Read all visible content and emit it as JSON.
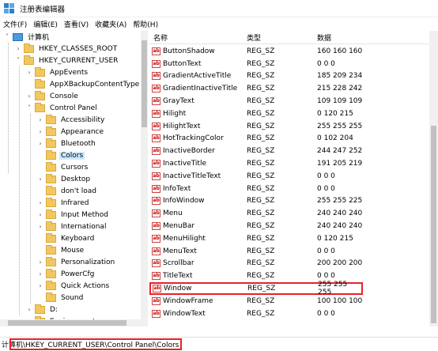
{
  "window": {
    "title": "注册表编辑器"
  },
  "menu": [
    "文件(F)",
    "编辑(E)",
    "查看(V)",
    "收藏夹(A)",
    "帮助(H)"
  ],
  "tree": {
    "items": [
      {
        "label": "计算机",
        "expander": "˅",
        "icon": "computer-icon",
        "selected": false
      },
      {
        "label": "HKEY_CLASSES_ROOT",
        "expander": "›",
        "icon": "folder-icon",
        "selected": false
      },
      {
        "label": "HKEY_CURRENT_USER",
        "expander": "˅",
        "icon": "folder-icon",
        "selected": false
      },
      {
        "label": "AppEvents",
        "expander": "›",
        "icon": "folder-icon",
        "selected": false
      },
      {
        "label": "AppXBackupContentType",
        "expander": "",
        "icon": "folder-icon",
        "selected": false
      },
      {
        "label": "Console",
        "expander": "›",
        "icon": "folder-icon",
        "selected": false
      },
      {
        "label": "Control Panel",
        "expander": "˅",
        "icon": "folder-icon",
        "selected": false
      },
      {
        "label": "Accessibility",
        "expander": "›",
        "icon": "folder-icon",
        "selected": false
      },
      {
        "label": "Appearance",
        "expander": "›",
        "icon": "folder-icon",
        "selected": false
      },
      {
        "label": "Bluetooth",
        "expander": "›",
        "icon": "folder-icon",
        "selected": false
      },
      {
        "label": "Colors",
        "expander": "",
        "icon": "folder-icon",
        "selected": true
      },
      {
        "label": "Cursors",
        "expander": "",
        "icon": "folder-icon",
        "selected": false
      },
      {
        "label": "Desktop",
        "expander": "›",
        "icon": "folder-icon",
        "selected": false
      },
      {
        "label": "don't load",
        "expander": "",
        "icon": "folder-icon",
        "selected": false
      },
      {
        "label": "Infrared",
        "expander": "›",
        "icon": "folder-icon",
        "selected": false
      },
      {
        "label": "Input Method",
        "expander": "›",
        "icon": "folder-icon",
        "selected": false
      },
      {
        "label": "International",
        "expander": "›",
        "icon": "folder-icon",
        "selected": false
      },
      {
        "label": "Keyboard",
        "expander": "",
        "icon": "folder-icon",
        "selected": false
      },
      {
        "label": "Mouse",
        "expander": "",
        "icon": "folder-icon",
        "selected": false
      },
      {
        "label": "Personalization",
        "expander": "›",
        "icon": "folder-icon",
        "selected": false
      },
      {
        "label": "PowerCfg",
        "expander": "›",
        "icon": "folder-icon",
        "selected": false
      },
      {
        "label": "Quick Actions",
        "expander": "›",
        "icon": "folder-icon",
        "selected": false
      },
      {
        "label": "Sound",
        "expander": "",
        "icon": "folder-icon",
        "selected": false
      },
      {
        "label": "D:",
        "expander": "›",
        "icon": "folder-icon",
        "selected": false
      },
      {
        "label": "Environment",
        "expander": "",
        "icon": "folder-icon",
        "selected": false
      }
    ]
  },
  "list": {
    "columns": [
      "名称",
      "类型",
      "数据"
    ],
    "rows": [
      {
        "name": "ButtonShadow",
        "type": "REG_SZ",
        "data": "160 160 160"
      },
      {
        "name": "ButtonText",
        "type": "REG_SZ",
        "data": "0 0 0"
      },
      {
        "name": "GradientActiveTitle",
        "type": "REG_SZ",
        "data": "185 209 234"
      },
      {
        "name": "GradientInactiveTitle",
        "type": "REG_SZ",
        "data": "215 228 242"
      },
      {
        "name": "GrayText",
        "type": "REG_SZ",
        "data": "109 109 109"
      },
      {
        "name": "Hilight",
        "type": "REG_SZ",
        "data": "0 120 215"
      },
      {
        "name": "HilightText",
        "type": "REG_SZ",
        "data": "255 255 255"
      },
      {
        "name": "HotTrackingColor",
        "type": "REG_SZ",
        "data": "0 102 204"
      },
      {
        "name": "InactiveBorder",
        "type": "REG_SZ",
        "data": "244 247 252"
      },
      {
        "name": "InactiveTitle",
        "type": "REG_SZ",
        "data": "191 205 219"
      },
      {
        "name": "InactiveTitleText",
        "type": "REG_SZ",
        "data": "0 0 0"
      },
      {
        "name": "InfoText",
        "type": "REG_SZ",
        "data": "0 0 0"
      },
      {
        "name": "InfoWindow",
        "type": "REG_SZ",
        "data": "255 255 225"
      },
      {
        "name": "Menu",
        "type": "REG_SZ",
        "data": "240 240 240"
      },
      {
        "name": "MenuBar",
        "type": "REG_SZ",
        "data": "240 240 240"
      },
      {
        "name": "MenuHilight",
        "type": "REG_SZ",
        "data": "0 120 215"
      },
      {
        "name": "MenuText",
        "type": "REG_SZ",
        "data": "0 0 0"
      },
      {
        "name": "Scrollbar",
        "type": "REG_SZ",
        "data": "200 200 200"
      },
      {
        "name": "TitleText",
        "type": "REG_SZ",
        "data": "0 0 0"
      },
      {
        "name": "Window",
        "type": "REG_SZ",
        "data": "255 255 255",
        "highlight": true
      },
      {
        "name": "WindowFrame",
        "type": "REG_SZ",
        "data": "100 100 100"
      },
      {
        "name": "WindowText",
        "type": "REG_SZ",
        "data": "0 0 0"
      }
    ],
    "value_icon_text": "ab"
  },
  "status": {
    "path": "计算机\\HKEY_CURRENT_USER\\Control Panel\\Colors"
  },
  "colors": {
    "highlight_outline": "#e8212a",
    "selection": "#cce8ff"
  }
}
